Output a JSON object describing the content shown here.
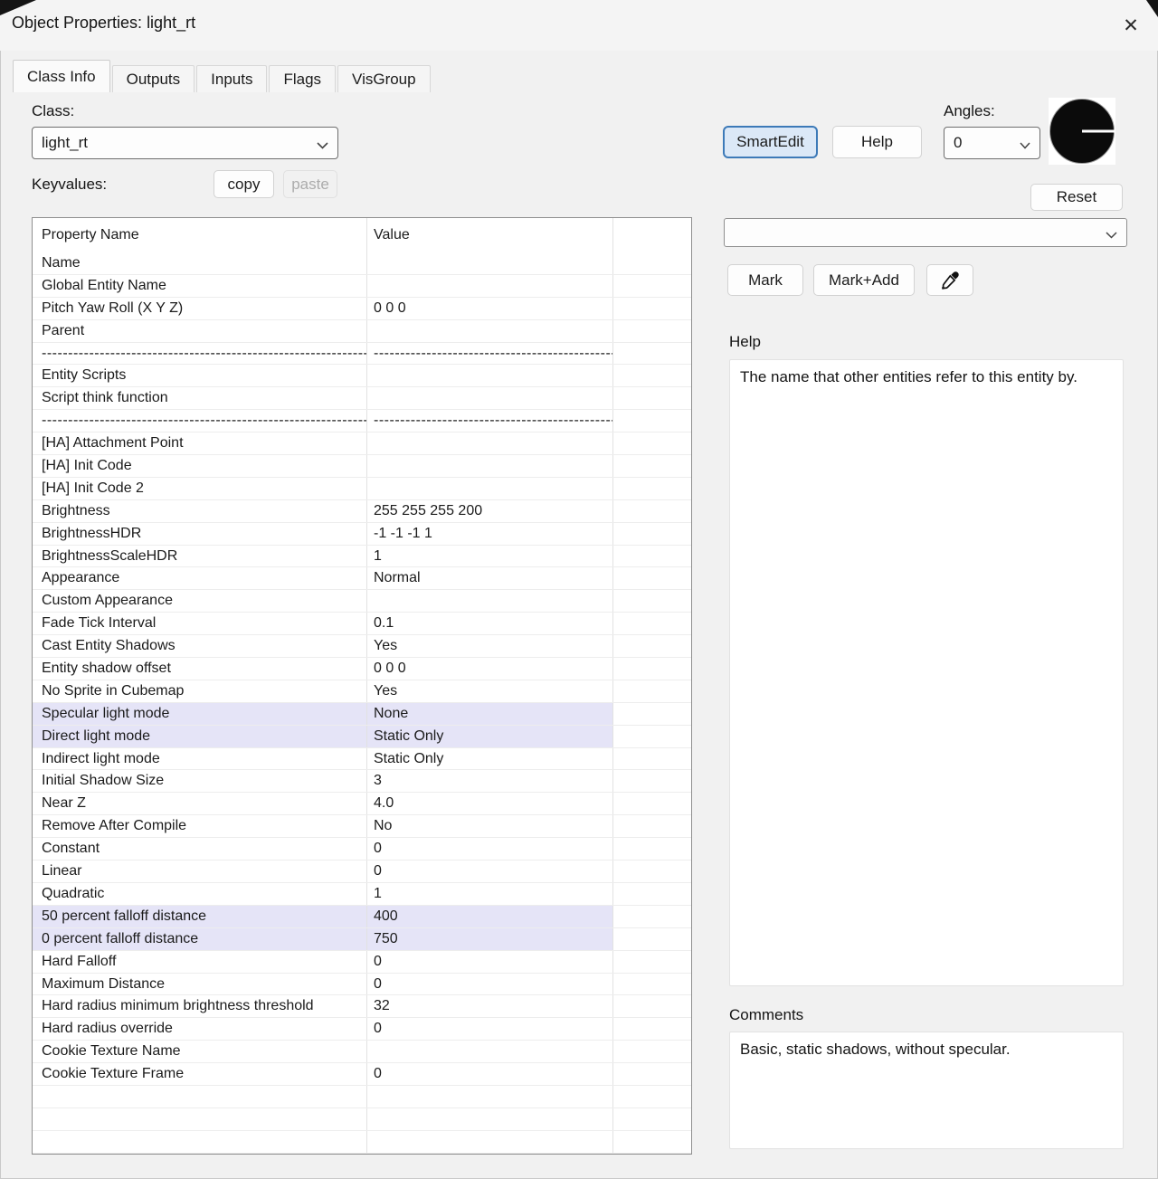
{
  "window": {
    "title": "Object Properties: light_rt"
  },
  "tabs": [
    {
      "label": "Class Info",
      "active": true
    },
    {
      "label": "Outputs",
      "active": false
    },
    {
      "label": "Inputs",
      "active": false
    },
    {
      "label": "Flags",
      "active": false
    },
    {
      "label": "VisGroup",
      "active": false
    }
  ],
  "class_section": {
    "label": "Class:",
    "value": "light_rt"
  },
  "keyvalues": {
    "label": "Keyvalues:",
    "copy_label": "copy",
    "paste_label": "paste"
  },
  "toolbar": {
    "smartedit_label": "SmartEdit",
    "help_label": "Help",
    "angles_label": "Angles:",
    "angles_value": "0",
    "reset_label": "Reset",
    "mark_label": "Mark",
    "mark_add_label": "Mark+Add"
  },
  "filter_combo": {
    "value": "",
    "placeholder": ""
  },
  "help_panel": {
    "title": "Help",
    "text": "The name that other entities refer to this entity by."
  },
  "comments_panel": {
    "title": "Comments",
    "text": "Basic, static shadows, without specular."
  },
  "table": {
    "headers": [
      "Property Name",
      "Value"
    ],
    "separator_dashes": "------------------------------------------------------------------------------------------------------------------------------------------------------------------------------",
    "rows": [
      {
        "name": "Name",
        "value": ""
      },
      {
        "name": "Global Entity Name",
        "value": ""
      },
      {
        "name": "Pitch Yaw Roll (X Y Z)",
        "value": "0 0 0"
      },
      {
        "name": "Parent",
        "value": ""
      },
      {
        "type": "separator"
      },
      {
        "name": "Entity Scripts",
        "value": ""
      },
      {
        "name": "Script think function",
        "value": ""
      },
      {
        "type": "separator"
      },
      {
        "name": "[HA] Attachment Point",
        "value": ""
      },
      {
        "name": "[HA] Init Code",
        "value": ""
      },
      {
        "name": "[HA] Init Code 2",
        "value": ""
      },
      {
        "name": "Brightness",
        "value": "255 255 255 200"
      },
      {
        "name": "BrightnessHDR",
        "value": "-1 -1 -1 1"
      },
      {
        "name": "BrightnessScaleHDR",
        "value": "1"
      },
      {
        "name": "Appearance",
        "value": "Normal"
      },
      {
        "name": "Custom Appearance",
        "value": ""
      },
      {
        "name": "Fade Tick Interval",
        "value": "0.1"
      },
      {
        "name": "Cast Entity Shadows",
        "value": "Yes"
      },
      {
        "name": "Entity shadow offset",
        "value": "0 0 0"
      },
      {
        "name": "No Sprite in Cubemap",
        "value": "Yes"
      },
      {
        "name": "Specular light mode",
        "value": "None",
        "highlighted": true
      },
      {
        "name": "Direct light mode",
        "value": "Static Only",
        "highlighted": true
      },
      {
        "name": "Indirect light mode",
        "value": "Static Only"
      },
      {
        "name": "Initial Shadow Size",
        "value": "3"
      },
      {
        "name": "Near Z",
        "value": "4.0"
      },
      {
        "name": "Remove After Compile",
        "value": "No"
      },
      {
        "name": "Constant",
        "value": "0"
      },
      {
        "name": "Linear",
        "value": "0"
      },
      {
        "name": "Quadratic",
        "value": "1"
      },
      {
        "name": "50 percent falloff distance",
        "value": "400",
        "highlighted": true
      },
      {
        "name": "0 percent falloff distance",
        "value": "750",
        "highlighted": true
      },
      {
        "name": "Hard Falloff",
        "value": "0"
      },
      {
        "name": "Maximum Distance",
        "value": "0"
      },
      {
        "name": "Hard radius minimum brightness threshold",
        "value": "32"
      },
      {
        "name": "Hard radius override",
        "value": "0"
      },
      {
        "name": "Cookie Texture Name",
        "value": ""
      },
      {
        "name": "Cookie Texture Frame",
        "value": "0"
      },
      {
        "type": "empty"
      },
      {
        "type": "empty"
      },
      {
        "type": "empty"
      }
    ]
  },
  "colors": {
    "row_highlight": "#e5e4f7",
    "smartedit_border": "#3d7ab8",
    "smartedit_bg": "#dbe8f7",
    "table_border": "#8f8f8f"
  }
}
